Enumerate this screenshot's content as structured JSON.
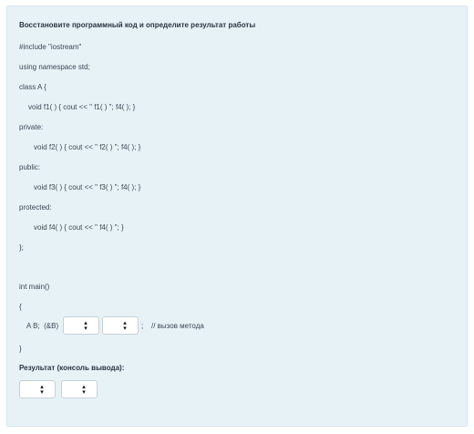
{
  "task_title": "Восстановите программный код и определите результат работы",
  "code_lines": [
    "#include \"iostream\"",
    "using namespace std;",
    "class A {",
    "void f1( ) { cout << \" f1( ) \"; f4( ); }",
    "private:",
    "void f2( ) { cout << \" f2( ) \"; f4( ); }",
    "public:",
    "void f3( ) { cout << \" f3( ) \"; f4( ); }",
    "protected:",
    "void f4( ) { cout << \" f4( ) \"; }",
    "};",
    "int main()",
    "{",
    "}"
  ],
  "call_line": {
    "prefix": "A B;  (&B)",
    "separator": ";",
    "comment": "// вызов метода"
  },
  "result_label": "Результат (консоль вывода):",
  "icons": {
    "select_arrow": "up-down-chevron-icon"
  }
}
